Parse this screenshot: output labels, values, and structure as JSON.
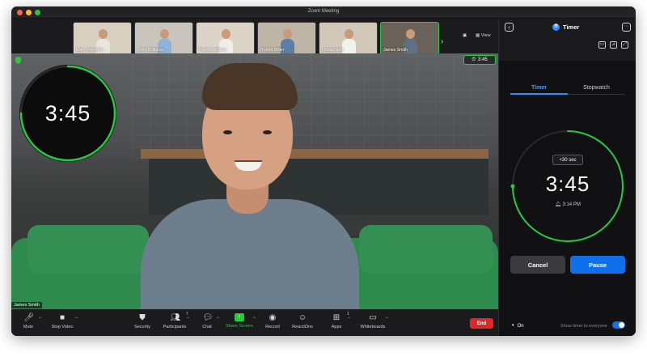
{
  "window": {
    "title": "Zoom Meeting"
  },
  "participants": [
    {
      "name": "Mary JohnsOn",
      "shirt": "#e9e4dc",
      "bg": "#d8cfc1"
    },
    {
      "name": "John Williams",
      "shirt": "#8db3d9",
      "bg": "#c9c5bd"
    },
    {
      "name": "Patricia JOnes",
      "shirt": "#f0ede6",
      "bg": "#dad3c6"
    },
    {
      "name": "Robert Miller",
      "shirt": "#5b7fa6",
      "bg": "#bfb5a6"
    },
    {
      "name": "Linda Davis",
      "shirt": "#f3f1ee",
      "bg": "#d1c8b9"
    },
    {
      "name": "James Smith",
      "shirt": "#5f7182",
      "bg": "#6a6258"
    }
  ],
  "strip": {
    "view_label": "View"
  },
  "main_video": {
    "speaker_name": "James Smith",
    "timer_badge": "3:45",
    "overlay_time": "3:45"
  },
  "toolbar": {
    "mute": "Mute",
    "stop_video": "Stop Video",
    "security": "Security",
    "participants": "Participants",
    "participants_count": "7",
    "chat": "Chat",
    "share_screen": "Share Screen",
    "record": "Record",
    "reactions": "ReactiOns",
    "apps": "Apps",
    "apps_count": "1",
    "whiteboards": "Whiteboards",
    "end": "End"
  },
  "panel": {
    "title": "Timer",
    "tabs": [
      "Timer",
      "Stopwatch"
    ],
    "active_tab": "Timer",
    "add_time": "+30 sec",
    "time_remaining": "3:45",
    "end_time": "3:14 PM",
    "cancel": "Cancel",
    "pause": "Pause",
    "sound": "On",
    "show_to_everyone": "Show timer to everyone",
    "show_to_everyone_enabled": true,
    "progress_fraction": 0.75
  },
  "colors": {
    "accent_green": "#27c93f",
    "accent_blue": "#0e71eb",
    "end_red": "#e02828"
  }
}
